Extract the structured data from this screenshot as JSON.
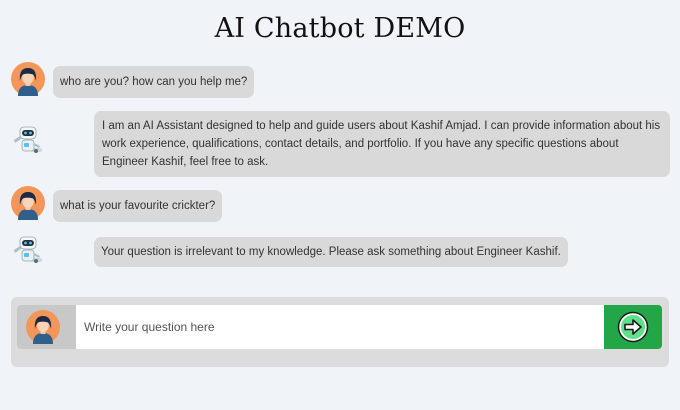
{
  "page": {
    "title": "AI Chatbot DEMO"
  },
  "messages": [
    {
      "role": "user",
      "text": "who are you? how can you help me?"
    },
    {
      "role": "bot",
      "text": "I am an AI Assistant designed to help and guide users about Kashif Amjad. I can provide information about his work experience, qualifications, contact details, and portfolio. If you have any specific questions about Engineer Kashif, feel free to ask."
    },
    {
      "role": "user",
      "text": "what is your favourite crickter?"
    },
    {
      "role": "bot",
      "text": "Your question is irrelevant to my knowledge. Please ask something about Engineer Kashif."
    }
  ],
  "composer": {
    "placeholder": "Write your question here",
    "value": "",
    "send_icon": "arrow-right-circle-icon"
  },
  "icons": {
    "user_avatar": "user-avatar-icon",
    "bot_avatar": "robot-avatar-icon"
  },
  "colors": {
    "page_bg": "#f0f4f8",
    "bubble_bg": "#d9d9d9",
    "send_button": "#22a648",
    "avatar_bg": "#f4955a",
    "avatar_hair": "#1f2a44",
    "avatar_shirt": "#2f5f8a"
  }
}
